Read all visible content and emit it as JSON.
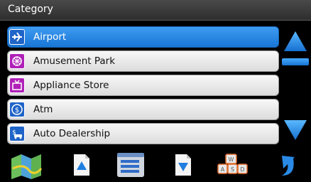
{
  "header": {
    "title": "Category"
  },
  "list": {
    "items": [
      {
        "label": "Airport",
        "icon": "airplane-icon",
        "selected": true
      },
      {
        "label": "Amusement Park",
        "icon": "amusement-park-icon",
        "selected": false
      },
      {
        "label": "Appliance Store",
        "icon": "tv-icon",
        "selected": false
      },
      {
        "label": "Atm",
        "icon": "dollar-coin-icon",
        "selected": false
      },
      {
        "label": "Auto Dealership",
        "icon": "car-dealership-icon",
        "selected": false
      }
    ]
  },
  "scroll": {
    "up_icon": "triangle-up-icon",
    "down_icon": "triangle-down-icon"
  },
  "toolbar": {
    "buttons": [
      {
        "name": "map-button",
        "icon": "map-icon"
      },
      {
        "name": "page-up-button",
        "icon": "page-up-icon"
      },
      {
        "name": "list-button",
        "icon": "list-icon"
      },
      {
        "name": "page-down-button",
        "icon": "page-down-icon"
      },
      {
        "name": "keyboard-button",
        "icon": "keyboard-icon"
      },
      {
        "name": "back-button",
        "icon": "back-arrow-icon"
      }
    ],
    "keyboard_keys": [
      "W",
      "A",
      "S",
      "D"
    ]
  },
  "colors": {
    "selected": "#1e80e0",
    "row_bg": "#eeeeee",
    "title_bg": "#3a3a3a",
    "accent_icon": "#1f64c8",
    "magenta_icon": "#b020b8"
  }
}
